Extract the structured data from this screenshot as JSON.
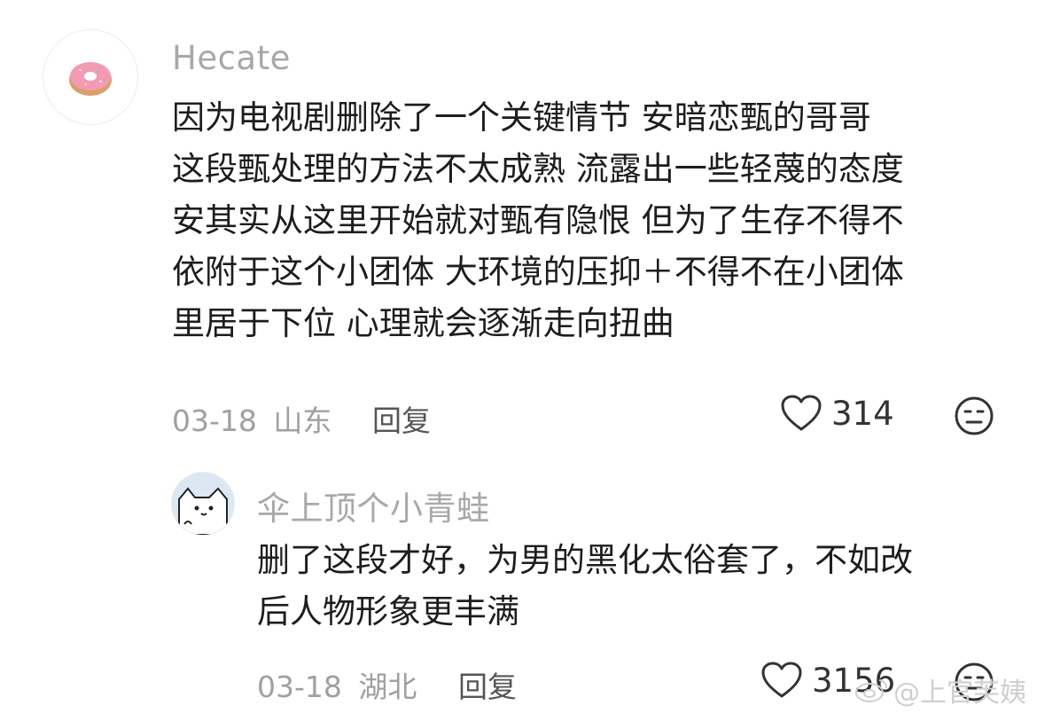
{
  "comments": [
    {
      "username": "Hecate",
      "lines": [
        "因为电视剧删除了一个关键情节 安暗恋甄的哥哥",
        "这段甄处理的方法不太成熟 流露出一些轻蔑的态度",
        "安其实从这里开始就对甄有隐恨 但为了生存不得不",
        "依附于这个小团体 大环境的压抑＋不得不在小团体",
        "里居于下位 心理就会逐渐走向扭曲"
      ],
      "date": "03-18",
      "location": "山东",
      "reply_label": "回复",
      "likes": "314",
      "avatar_icon": "donut-icon"
    },
    {
      "username": "伞上顶个小青蛙",
      "lines": [
        "删了这段才好，为男的黑化太俗套了，不如改",
        "后人物形象更丰满"
      ],
      "date": "03-18",
      "location": "湖北",
      "reply_label": "回复",
      "likes": "3156",
      "avatar_icon": "cartoon-cat-icon"
    }
  ],
  "watermark": {
    "text": "@上官芙姨",
    "icon": "weibo-icon"
  },
  "colors": {
    "meta": "#a0a0a0",
    "username": "#a8a8a8",
    "text": "#1d1d1d"
  }
}
